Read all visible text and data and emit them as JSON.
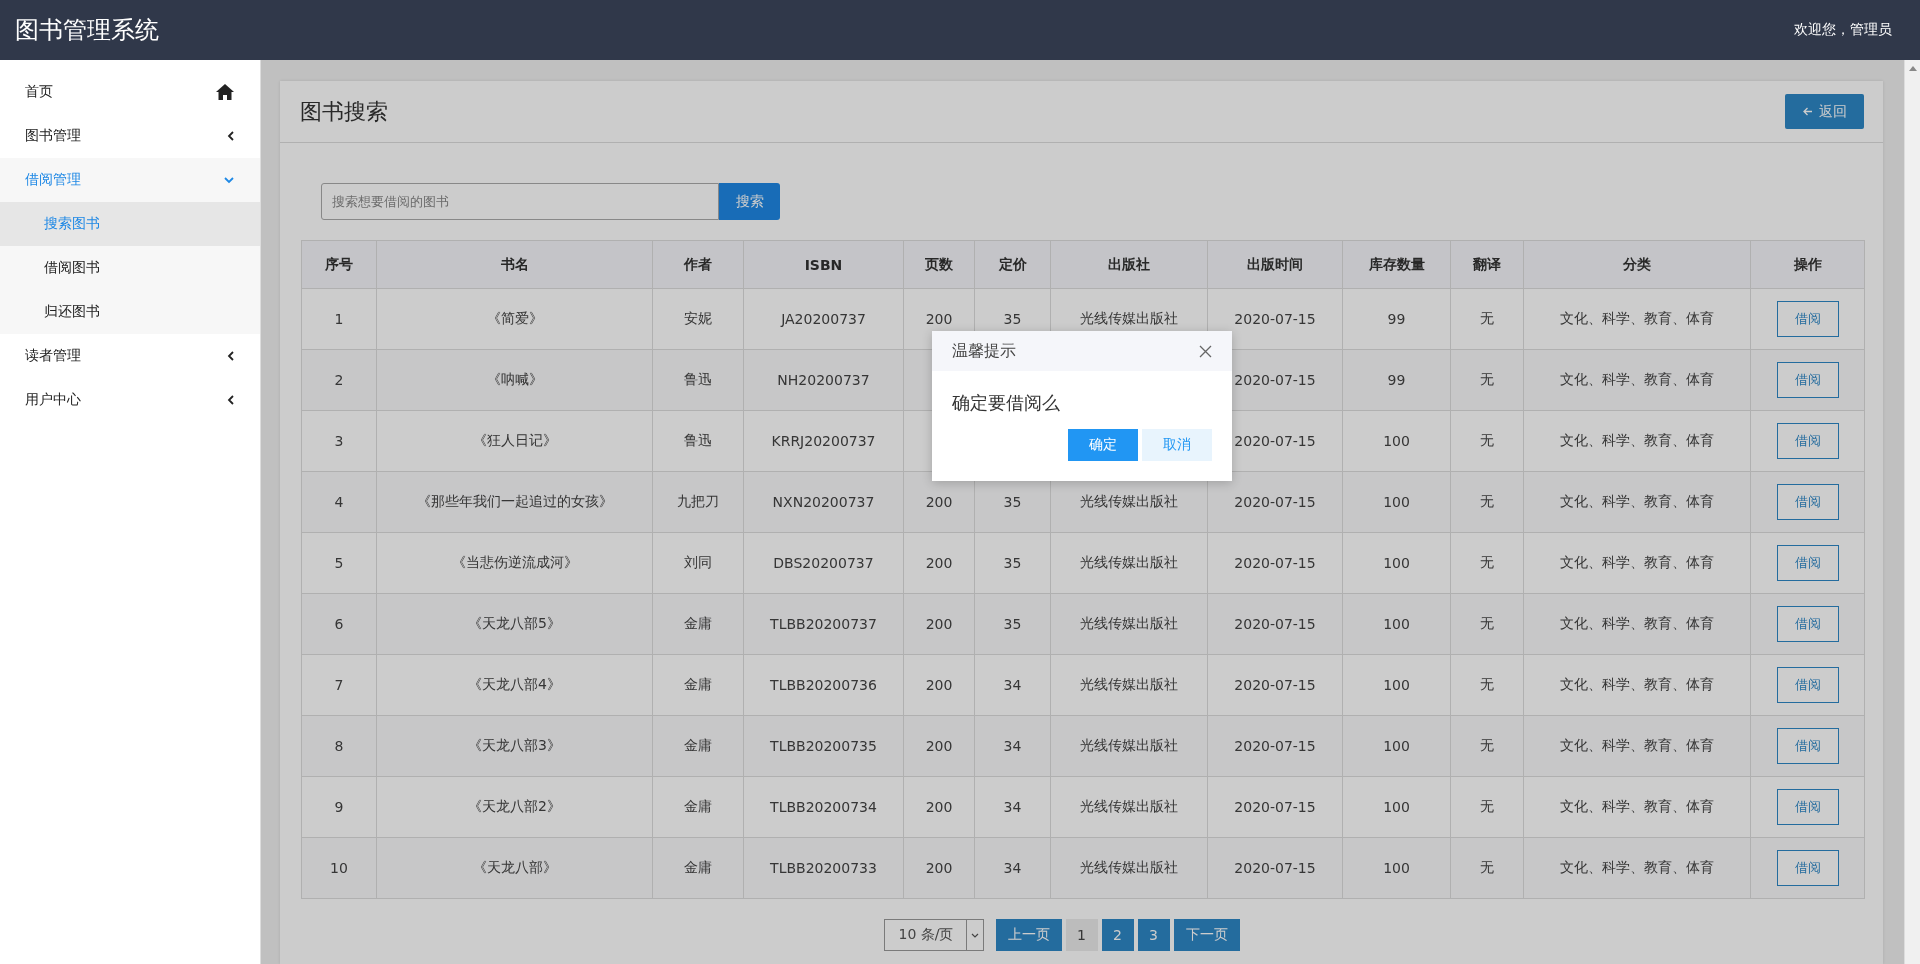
{
  "header": {
    "title": "图书管理系统",
    "greeting": "欢迎您，管理员"
  },
  "sidebar": {
    "items": [
      {
        "kind": "home",
        "label": "首页",
        "selected": false
      },
      {
        "kind": "menu",
        "label": "图书管理",
        "expanded": false,
        "selected": false
      },
      {
        "kind": "menu",
        "label": "借阅管理",
        "expanded": true,
        "selected": true,
        "children": [
          {
            "label": "搜索图书",
            "selected": true
          },
          {
            "label": "借阅图书",
            "selected": false
          },
          {
            "label": "归还图书",
            "selected": false
          }
        ]
      },
      {
        "kind": "menu",
        "label": "读者管理",
        "expanded": false,
        "selected": false
      },
      {
        "kind": "menu",
        "label": "用户中心",
        "expanded": false,
        "selected": false
      }
    ]
  },
  "panel": {
    "title": "图书搜索",
    "back_button": "返回"
  },
  "search": {
    "placeholder": "搜索想要借阅的图书",
    "button": "搜索"
  },
  "table": {
    "columns": [
      "序号",
      "书名",
      "作者",
      "ISBN",
      "页数",
      "定价",
      "出版社",
      "出版时间",
      "库存数量",
      "翻译",
      "分类",
      "操作"
    ],
    "rows": [
      {
        "cells": [
          "1",
          "《简爱》",
          "安妮",
          "JA20200737",
          "200",
          "35",
          "光线传媒出版社",
          "2020-07-15",
          "99",
          "无",
          "文化、科学、教育、体育"
        ],
        "action": "借阅"
      },
      {
        "cells": [
          "2",
          "《呐喊》",
          "鲁迅",
          "NH20200737",
          null,
          null,
          null,
          "2020-07-15",
          "99",
          "无",
          "文化、科学、教育、体育"
        ],
        "action": "借阅"
      },
      {
        "cells": [
          "3",
          "《狂人日记》",
          "鲁迅",
          "KRRJ20200737",
          null,
          null,
          null,
          "2020-07-15",
          "100",
          "无",
          "文化、科学、教育、体育"
        ],
        "action": "借阅"
      },
      {
        "cells": [
          "4",
          "《那些年我们一起追过的女孩》",
          "九把刀",
          "NXN20200737",
          "200",
          "35",
          "光线传媒出版社",
          "2020-07-15",
          "100",
          "无",
          "文化、科学、教育、体育"
        ],
        "action": "借阅"
      },
      {
        "cells": [
          "5",
          "《当悲伤逆流成河》",
          "刘同",
          "DBS20200737",
          "200",
          "35",
          "光线传媒出版社",
          "2020-07-15",
          "100",
          "无",
          "文化、科学、教育、体育"
        ],
        "action": "借阅"
      },
      {
        "cells": [
          "6",
          "《天龙八部5》",
          "金庸",
          "TLBB20200737",
          "200",
          "35",
          "光线传媒出版社",
          "2020-07-15",
          "100",
          "无",
          "文化、科学、教育、体育"
        ],
        "action": "借阅"
      },
      {
        "cells": [
          "7",
          "《天龙八部4》",
          "金庸",
          "TLBB20200736",
          "200",
          "34",
          "光线传媒出版社",
          "2020-07-15",
          "100",
          "无",
          "文化、科学、教育、体育"
        ],
        "action": "借阅"
      },
      {
        "cells": [
          "8",
          "《天龙八部3》",
          "金庸",
          "TLBB20200735",
          "200",
          "34",
          "光线传媒出版社",
          "2020-07-15",
          "100",
          "无",
          "文化、科学、教育、体育"
        ],
        "action": "借阅"
      },
      {
        "cells": [
          "9",
          "《天龙八部2》",
          "金庸",
          "TLBB20200734",
          "200",
          "34",
          "光线传媒出版社",
          "2020-07-15",
          "100",
          "无",
          "文化、科学、教育、体育"
        ],
        "action": "借阅"
      },
      {
        "cells": [
          "10",
          "《天龙八部》",
          "金庸",
          "TLBB20200733",
          "200",
          "34",
          "光线传媒出版社",
          "2020-07-15",
          "100",
          "无",
          "文化、科学、教育、体育"
        ],
        "action": "借阅"
      }
    ]
  },
  "pagination": {
    "page_size": "10 条/页",
    "prev": "上一页",
    "pages": [
      {
        "label": "1",
        "selected": true
      },
      {
        "label": "2",
        "selected": false
      },
      {
        "label": "3",
        "selected": false
      }
    ],
    "next": "下一页"
  },
  "dialog": {
    "title": "温馨提示",
    "message": "确定要借阅么",
    "confirm": "确定",
    "cancel": "取消"
  }
}
